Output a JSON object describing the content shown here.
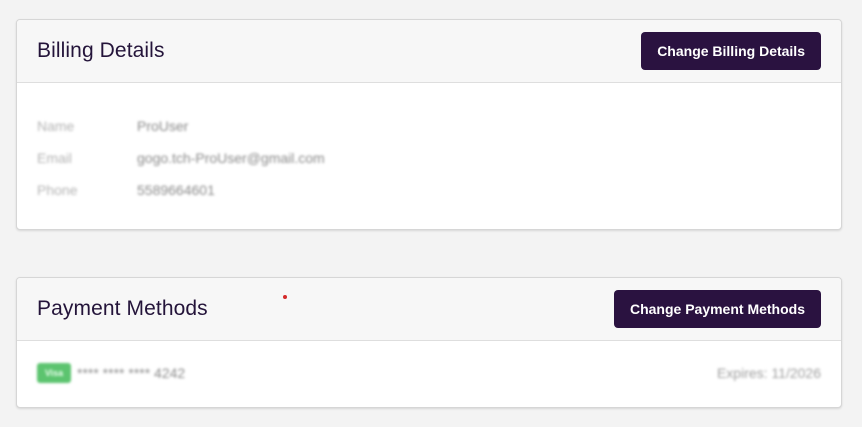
{
  "billing": {
    "title": "Billing Details",
    "button_label": "Change Billing Details",
    "fields": [
      {
        "label": "Name",
        "value": "ProUser"
      },
      {
        "label": "Email",
        "value": "gogo.tch-ProUser@gmail.com"
      },
      {
        "label": "Phone",
        "value": "5589664601"
      }
    ]
  },
  "payment": {
    "title": "Payment Methods",
    "button_label": "Change Payment Methods",
    "card": {
      "brand": "Visa",
      "number": "**** **** **** 4242",
      "expiry": "Expires: 11/2026"
    }
  },
  "colors": {
    "primary_button": "#2a1240",
    "card_brand_badge": "#5cc46f",
    "page_background": "#f3f3f3"
  }
}
